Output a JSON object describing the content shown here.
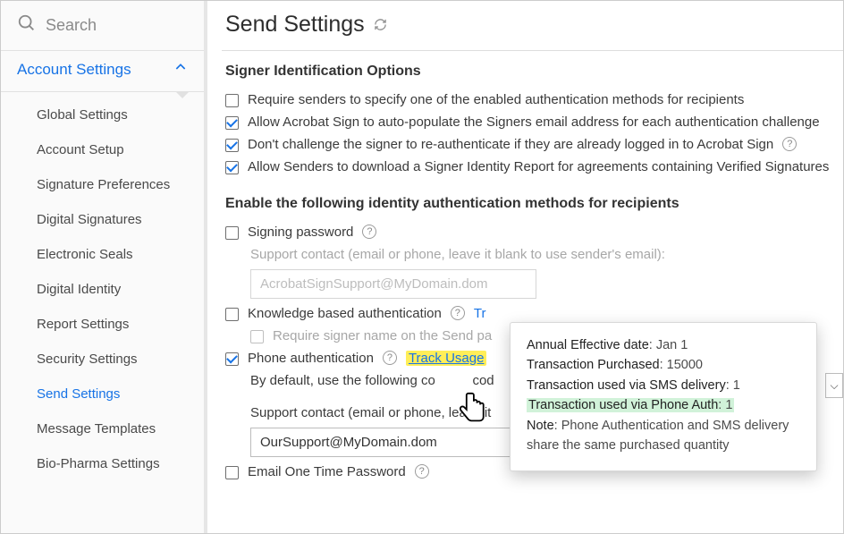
{
  "search": {
    "placeholder": "Search"
  },
  "sidebar": {
    "section": "Account Settings",
    "items": [
      "Global Settings",
      "Account Setup",
      "Signature Preferences",
      "Digital Signatures",
      "Electronic Seals",
      "Digital Identity",
      "Report Settings",
      "Security Settings",
      "Send Settings",
      "Message Templates",
      "Bio-Pharma Settings"
    ],
    "active_index": 8
  },
  "page": {
    "title": "Send Settings",
    "group1_title": "Signer Identification Options",
    "opt_require": "Require senders to specify one of the enabled authentication methods for recipients",
    "opt_autopop": "Allow Acrobat Sign to auto-populate the Signers email address for each authentication challenge",
    "opt_nochallenge": "Don't challenge the signer to re-authenticate if they are already logged in to Acrobat Sign",
    "opt_download": "Allow Senders to download a Signer Identity Report for agreements containing Verified Signatures",
    "group2_title": "Enable the following identity authentication methods for recipients",
    "signing_pw": "Signing password",
    "support_hint": "Support contact (email or phone, leave it blank to use sender's email):",
    "support_ph_disabled": "AcrobatSignSupport@MyDomain.dom",
    "kba": "Knowledge based authentication",
    "kba_link": "Tr",
    "kba_sub": "Require signer name on the Send pa",
    "phone_auth": "Phone authentication",
    "track_usage": "Track Usage",
    "default_cc": "By default, use the following co",
    "default_cc2": " cod",
    "support2": "Support contact (email or phone, leave it",
    "support_val": "OurSupport@MyDomain.dom",
    "otp": "Email One Time Password"
  },
  "popup": {
    "l1a": "Annual Effective date",
    "l1b": ": Jan 1",
    "l2a": "Transaction Purchased",
    "l2b": ": 15000",
    "l3a": "Transaction used via SMS delivery",
    "l3b": ": 1",
    "l4a": "Transaction used via Phone Auth",
    "l4b": ": 1",
    "l5a": "Note",
    "l5b": ": Phone Authentication and SMS delivery share the same purchased quantity"
  }
}
